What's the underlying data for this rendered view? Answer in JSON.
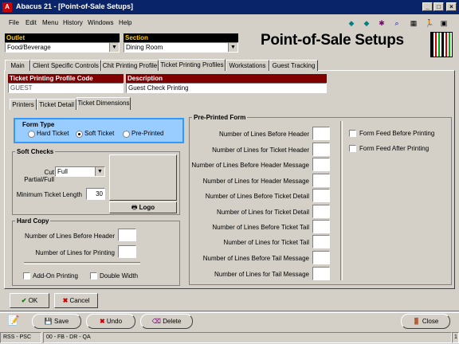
{
  "window": {
    "title": "Abacus 21 - [Point-of-Sale Setups]"
  },
  "menu": [
    "File",
    "Edit",
    "Menu",
    "History",
    "Windows",
    "Help"
  ],
  "toolbar_icons": [
    "up-arrow-icon",
    "down-arrow-icon",
    "bug-icon",
    "search-icon",
    "calculator-icon",
    "runner-icon",
    "window-icon"
  ],
  "outlet": {
    "label": "Outlet",
    "value": "Food/Beverage"
  },
  "section": {
    "label": "Section",
    "value": "Dining Room"
  },
  "page_title": "Point-of-Sale Setups",
  "main_tabs": [
    "Main",
    "Client Specific Controls",
    "Chit Printing Profile",
    "Ticket Printing Profiles",
    "Workstations",
    "Guest Tracking"
  ],
  "profile_code": {
    "label": "Ticket Printing Profile Code",
    "value": "GUEST"
  },
  "description": {
    "label": "Description",
    "value": "Guest Check Printing"
  },
  "sub_tabs": [
    "Printers",
    "Ticket Detail",
    "Ticket Dimensions"
  ],
  "form_type": {
    "title": "Form Type",
    "options": [
      "Hard Ticket",
      "Soft Ticket",
      "Pre-Printed"
    ],
    "selected": "Soft Ticket"
  },
  "soft_checks": {
    "title": "Soft Checks",
    "cut_label": "Cut Partial/Full",
    "cut_value": "Full",
    "min_len_label": "Minimum Ticket Length",
    "min_len_value": "30",
    "logo_button": "Logo"
  },
  "hard_copy": {
    "title": "Hard Copy",
    "lines_before_header_label": "Number of Lines Before Header",
    "lines_printing_label": "Number of Lines for Printing",
    "addon_label": "Add-On Printing",
    "double_width_label": "Double Width"
  },
  "preprinted": {
    "title": "Pre-Printed Form",
    "fields": [
      "Number of Lines Before Header",
      "Number of Lines for Ticket Header",
      "Number of Lines Before Header Message",
      "Number of Lines for Header Message",
      "Number of Lines Before Ticket Detail",
      "Number of Lines for Ticket Detail",
      "Number of Lines Before Ticket Tail",
      "Number of Lines for Ticket Tail",
      "Number of Lines Before Tail Message",
      "Number of Lines for Tail Message"
    ],
    "form_feed_before": "Form Feed Before Printing",
    "form_feed_after": "Form Feed After Printing"
  },
  "dialog_buttons": {
    "ok": "OK",
    "cancel": "Cancel"
  },
  "bottom_buttons": {
    "save": "Save",
    "undo": "Undo",
    "delete": "Delete",
    "close": "Close"
  },
  "status": {
    "left": "RSS - PSC",
    "mid": "00 - FB - DR - QA",
    "page": "1"
  },
  "colors": {
    "titlebar": "#0a246a",
    "form_type_bg": "#99ccff",
    "label_red": "#800000",
    "label_black": "#000000"
  }
}
